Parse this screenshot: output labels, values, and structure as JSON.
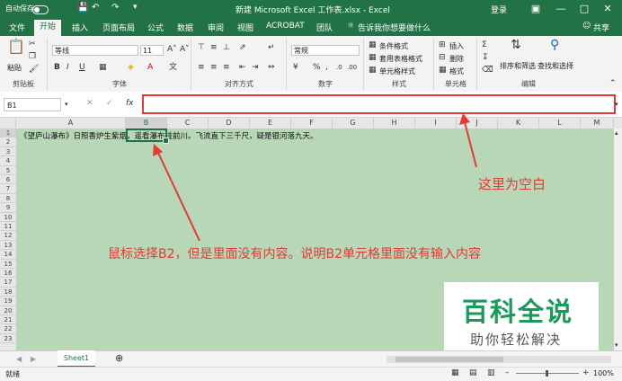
{
  "titlebar": {
    "autosave": "自动保存",
    "doc_title": "新建 Microsoft Excel 工作表.xlsx - Excel",
    "signin": "登录"
  },
  "tabs": [
    "文件",
    "开始",
    "插入",
    "页面布局",
    "公式",
    "数据",
    "审阅",
    "视图",
    "ACROBAT",
    "团队"
  ],
  "tell_me": "告诉我你想要做什么",
  "share": "共享",
  "ribbon": {
    "paste": "粘贴",
    "font_name": "等线",
    "font_size": "11",
    "number_format": "常规",
    "cond_format": "条件格式",
    "table_format": "套用表格格式",
    "cell_style": "单元格样式",
    "insert": "插入",
    "delete": "删除",
    "format": "格式",
    "sort_filter": "排序和筛选",
    "find_select": "查找和选择",
    "groups": {
      "clipboard": "剪贴板",
      "font": "字体",
      "alignment": "对齐方式",
      "number": "数字",
      "styles": "样式",
      "cells": "单元格",
      "editing": "编辑"
    }
  },
  "formula_bar": {
    "name_box": "B1",
    "fx": "fx",
    "content": ""
  },
  "columns": [
    "A",
    "B",
    "C",
    "D",
    "E",
    "F",
    "G",
    "H",
    "I",
    "J",
    "K",
    "L",
    "M"
  ],
  "rows": [
    "1",
    "2",
    "3",
    "4",
    "5",
    "6",
    "7",
    "8",
    "9",
    "10",
    "11",
    "12",
    "13",
    "14",
    "15",
    "16",
    "17",
    "18",
    "19",
    "20",
    "21",
    "22",
    "23"
  ],
  "cell_a1": "《望庐山瀑布》日照香炉生紫烟，遥看瀑布挂前川。飞流直下三千尺，疑是银河落九天。",
  "sheet_tab": "Sheet1",
  "status": {
    "ready": "就绪",
    "zoom": "100%"
  },
  "annotations": {
    "formula_note": "这里为空白",
    "cell_note": "鼠标选择B2，但是里面没有内容。说明B2单元格里面没有输入内容"
  },
  "watermark": {
    "big": "百科全说",
    "small": "助你轻松解决"
  },
  "colors": {
    "excel_green": "#217346",
    "annotation_red": "#e53935",
    "grid_bg": "#cce8cc"
  }
}
